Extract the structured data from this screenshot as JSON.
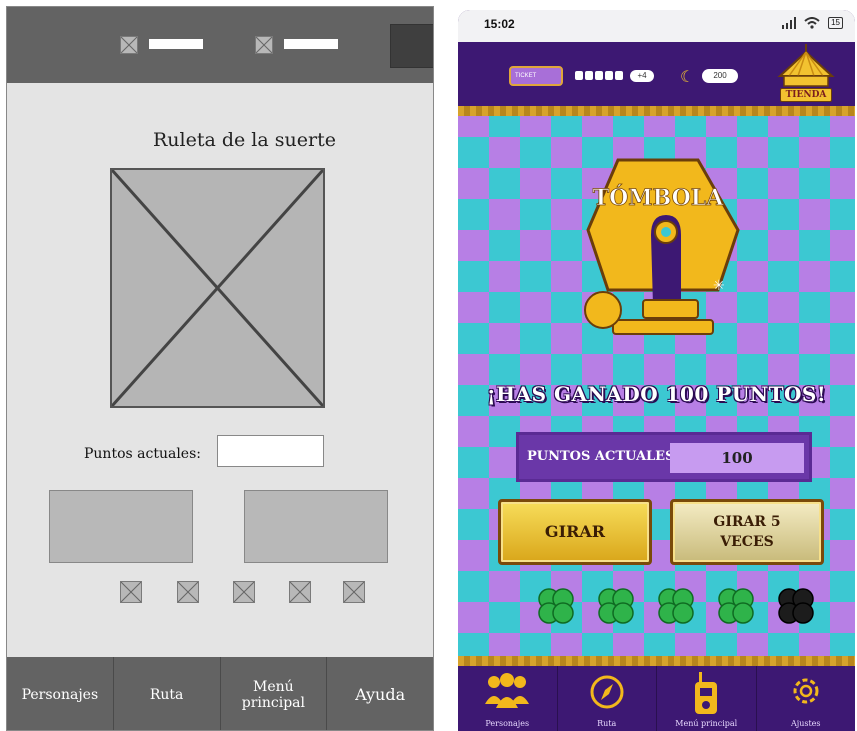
{
  "wireframe": {
    "title": "Ruleta de la suerte",
    "points_label": "Puntos actuales:",
    "points_value": "",
    "nav": [
      "Personajes",
      "Ruta",
      "Menú principal",
      "Ayuda"
    ]
  },
  "mockup": {
    "status": {
      "time": "15:02",
      "battery": "15"
    },
    "hud": {
      "ticket_label": "TICKET",
      "plus_label": "+4",
      "coins": "200",
      "shop_label": "TIENDA"
    },
    "logo_text": "TÓMBOLA",
    "win_message": "¡HAS GANADO 100 PUNTOS!",
    "points_label": "PUNTOS ACTUALES:",
    "points_value": "100",
    "spin_button": "GIRAR",
    "spin5_button_line1": "GIRAR 5",
    "spin5_button_line2": "VECES",
    "clovers": [
      {
        "state": "green",
        "icon": "clover-icon"
      },
      {
        "state": "green",
        "icon": "clover-icon"
      },
      {
        "state": "green",
        "icon": "clover-icon"
      },
      {
        "state": "green",
        "icon": "clover-icon"
      },
      {
        "state": "black",
        "icon": "clover-icon"
      }
    ],
    "nav": [
      {
        "label": "Personajes",
        "icon": "people-icon"
      },
      {
        "label": "Ruta",
        "icon": "compass-icon"
      },
      {
        "label": "Menú principal",
        "icon": "walkie-talkie-icon"
      },
      {
        "label": "Ajustes",
        "icon": "gear-icon"
      }
    ],
    "colors": {
      "gold": "#f2c230",
      "purple_dark": "#3d1873",
      "purple_light": "#b77fe5",
      "cyan": "#3cc8d2"
    }
  }
}
